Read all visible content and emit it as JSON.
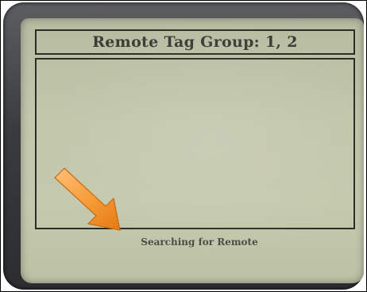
{
  "screen": {
    "title": "Remote Tag Group: 1, 2",
    "status": "Searching for Remote"
  },
  "annotation": {
    "icon": "arrow-pointer-icon",
    "color": "#f0902a"
  }
}
